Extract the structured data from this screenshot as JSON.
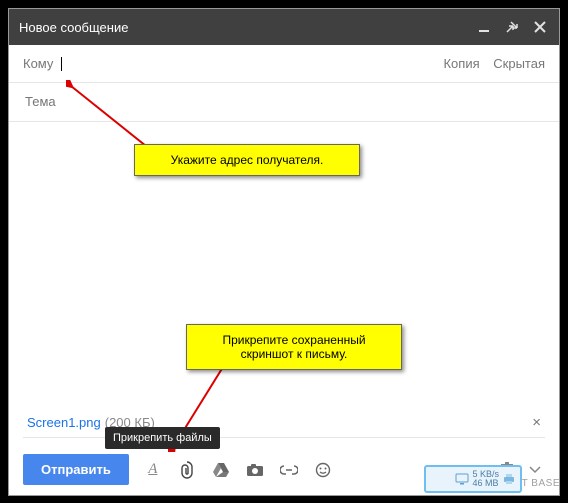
{
  "titlebar": {
    "title": "Новое сообщение"
  },
  "fields": {
    "to_label": "Кому",
    "cc": "Копия",
    "bcc": "Скрытая",
    "subject_placeholder": "Тема"
  },
  "callout1": "Укажите адрес получателя.",
  "callout2_line1": "Прикрепите сохраненный",
  "callout2_line2": "скриншот к письму.",
  "tooltip_attach": "Прикрепить файлы",
  "attachment": {
    "name": "Screen1.png",
    "size": "(200 КБ)"
  },
  "toolbar": {
    "send": "Отправить"
  },
  "netbox": {
    "speed": "5 KB/s",
    "total": "46 MB"
  },
  "watermark": "SOFT   BASE"
}
